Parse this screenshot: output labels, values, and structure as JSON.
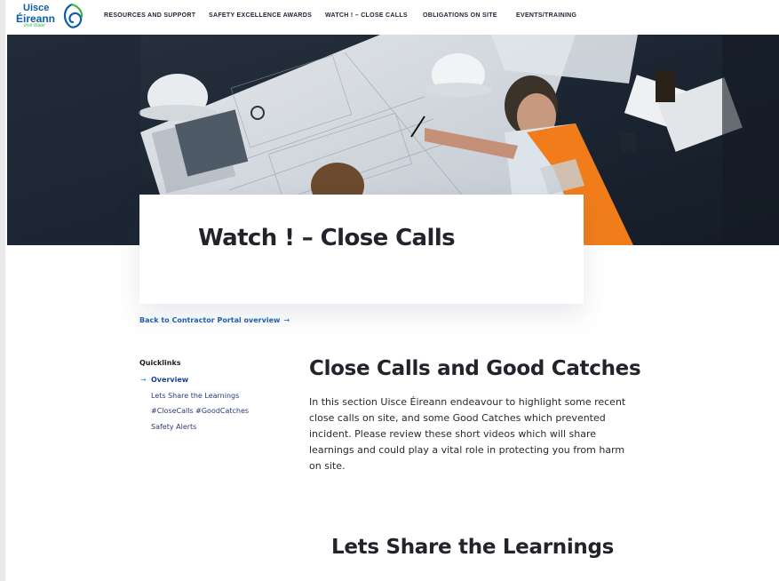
{
  "brand": {
    "line1": "Uisce",
    "line2": "Éireann",
    "line3": "Irish Water",
    "color_primary": "#0b5ea8",
    "color_secondary": "#39b54a"
  },
  "nav": {
    "items": [
      {
        "label": "RESOURCES AND SUPPORT"
      },
      {
        "label": "SAFETY EXCELLENCE AWARDS"
      },
      {
        "label": "WATCH ! – CLOSE CALLS"
      },
      {
        "label": "OBLIGATIONS ON SITE"
      },
      {
        "label": "EVENTS/TRAINING"
      }
    ]
  },
  "hero": {
    "title": "Watch ! – Close Calls"
  },
  "back_link": {
    "label": "Back to Contractor Portal overview",
    "arrow": "→"
  },
  "quicklinks": {
    "title": "Quicklinks",
    "active_marker": "→",
    "items": [
      {
        "label": "Overview",
        "active": true
      },
      {
        "label": "Lets Share the Learnings",
        "active": false
      },
      {
        "label": "#CloseCalls #GoodCatches",
        "active": false
      },
      {
        "label": "Safety Alerts",
        "active": false
      }
    ]
  },
  "main": {
    "heading": "Close Calls and Good Catches",
    "body": "In this section Uisce Éireann endeavour to highlight some recent close calls on site, and some Good Catches which prevented incident. Please review these short videos which will share learnings and could play a vital role in protecting you from harm on site.",
    "section_heading": "Lets Share the Learnings"
  },
  "colors": {
    "link": "#1d5fb5",
    "nav_text": "#20243a",
    "heading": "#23232b"
  }
}
